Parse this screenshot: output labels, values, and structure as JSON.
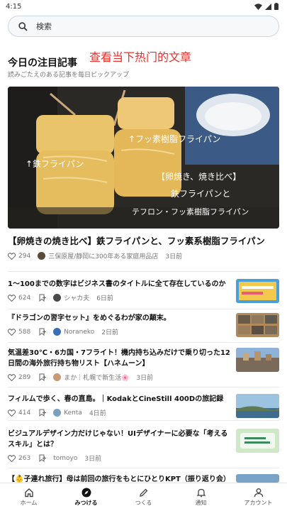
{
  "status": {
    "time": "4:15"
  },
  "search": {
    "placeholder": "検索"
  },
  "overlay_note": "查看当下热门的文章",
  "section": {
    "title": "今日の注目記事",
    "subtitle": "読みごたえのある記事を毎日ピックアップ"
  },
  "hero": {
    "image_text": {
      "label_left": "↑鉄フライパン",
      "label_right": "↑フッ素樹脂フライパン",
      "caption_line1": "【卵焼き、焼き比べ】",
      "caption_line2": "鉄フライパンと",
      "caption_line3": "テフロン・フッ素樹脂フライパン"
    },
    "title": "【卵焼きの焼き比べ】鉄フライパンと、フッ素系樹脂フライパン",
    "likes": "294",
    "author": "三保原屋/静岡に300年ある家庭用品店",
    "time": "3日前"
  },
  "articles": [
    {
      "title": "1〜100までの数字はビジネス書のタイトルに全て存在しているのか",
      "likes": "624",
      "author": "シャカ夫",
      "time": "6日前",
      "thumb_color": "#4b9fd8"
    },
    {
      "title": "『ドラゴンの習字セット』をめぐるわが家の顛末。",
      "likes": "588",
      "author": "Noraneko",
      "time": "2日前",
      "thumb_color": "#b08a5a"
    },
    {
      "title": "気温差30℃・6カ国・7フライト！機内持ち込みだけで乗り切った12日間の海外旅行持ち物リスト【ハネムーン】",
      "likes": "289",
      "author": "まか｜札幌で新生活🌸",
      "time": "3日前",
      "thumb_color": "#6f8fb5"
    },
    {
      "title": "フィルムで歩く、春の直島。｜KodakとCineStill 400Dの旅記録",
      "likes": "414",
      "author": "Kenta",
      "time": "4日前",
      "thumb_color": "#5a86a8"
    },
    {
      "title": "ビジュアルデザイン力だけじゃない！UIデザイナーに必要な「考えるスキル」とは？",
      "likes": "263",
      "author": "tomoyo",
      "time": "3日前",
      "thumb_color": "#cfe8c8"
    },
    {
      "title": "【👶子連れ旅行】母は前回の旅行をもとにひとりKPT（振り返り会）を",
      "likes": "",
      "author": "",
      "time": "",
      "thumb_color": "#7aa3c8"
    }
  ],
  "nav": {
    "items": [
      {
        "label": "ホーム"
      },
      {
        "label": "みつける"
      },
      {
        "label": "つくる"
      },
      {
        "label": "通知"
      },
      {
        "label": "アカウント"
      }
    ]
  }
}
